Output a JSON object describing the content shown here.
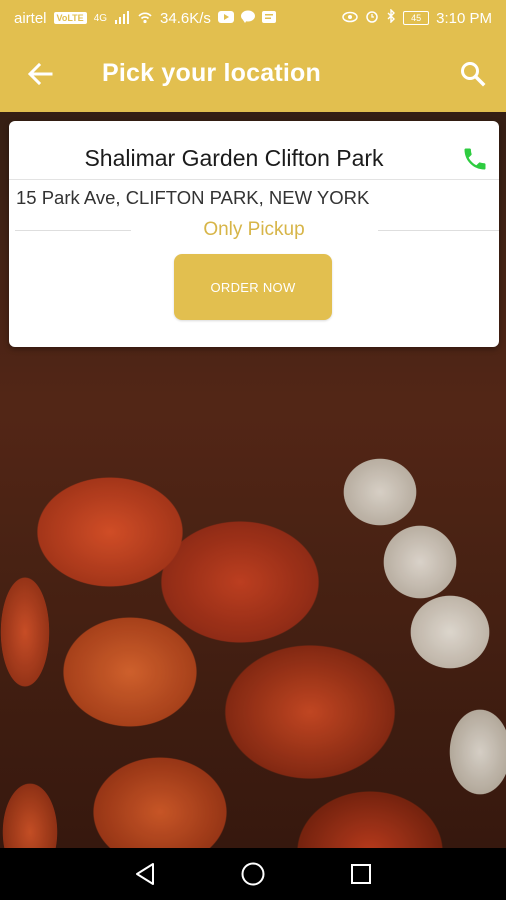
{
  "status_bar": {
    "carrier": "airtel",
    "volte": "VoLTE",
    "network": "4G",
    "speed": "34.6K/s",
    "battery": "45",
    "time": "3:10 PM"
  },
  "app_bar": {
    "title": "Pick your location",
    "back_icon": "arrow-back-icon",
    "search_icon": "search-icon"
  },
  "location_card": {
    "store_name": "Shalimar Garden Clifton Park",
    "address": "15 Park Ave, CLIFTON PARK, NEW YORK",
    "service_mode": "Only Pickup",
    "order_button_label": "ORDER NOW",
    "phone_icon": "phone-icon"
  },
  "nav_bar": {
    "back": "nav-back-icon",
    "home": "nav-home-icon",
    "recents": "nav-recents-icon"
  },
  "colors": {
    "accent": "#e2bf4f",
    "pickup_text": "#d7b548",
    "phone_green": "#2ecc40"
  }
}
